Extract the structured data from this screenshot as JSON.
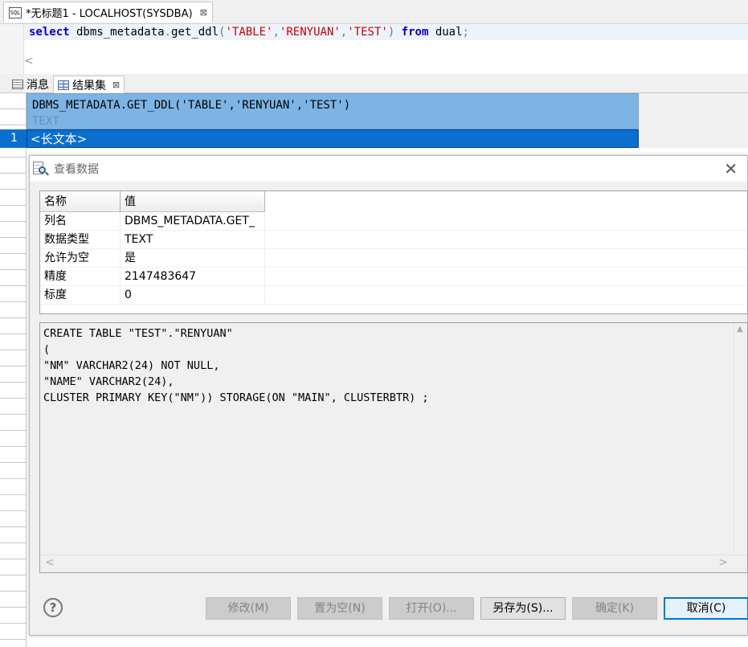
{
  "editor_tab": {
    "icon": "sql-icon",
    "title": "*无标题1 - LOCALHOST(SYSDBA)",
    "close": "⊠"
  },
  "editor": {
    "keyword_select": "select",
    "func": " dbms_metadata",
    "dot": ".",
    "func2": "get_ddl",
    "open": "(",
    "arg1": "'TABLE'",
    "comma1": ",",
    "arg2": "'RENYUAN'",
    "comma2": ",",
    "arg3": "'TEST'",
    "close": ") ",
    "keyword_from": "from",
    "table": " dual",
    "semicolon": ";",
    "scroll_left": "<"
  },
  "result_tabs": [
    {
      "label": "消息",
      "icon": "message-icon"
    },
    {
      "label": "结果集",
      "icon": "grid-icon",
      "close": "⊠"
    }
  ],
  "result_grid": {
    "column": "DBMS_METADATA.GET_DDL('TABLE','RENYUAN','TEST')",
    "column_type": "TEXT",
    "row_number": "1",
    "cell_value": "<长文本>"
  },
  "dialog": {
    "title": "查看数据",
    "close": "✕",
    "props_headers": [
      "名称",
      "值"
    ],
    "props_rows": [
      {
        "name": "列名",
        "value": "DBMS_METADATA.GET_"
      },
      {
        "name": "数据类型",
        "value": "TEXT"
      },
      {
        "name": "允许为空",
        "value": "是"
      },
      {
        "name": "精度",
        "value": "2147483647"
      },
      {
        "name": "标度",
        "value": "0"
      }
    ],
    "text_content": "CREATE TABLE \"TEST\".\"RENYUAN\"\n(\n\"NM\" VARCHAR2(24) NOT NULL,\n\"NAME\" VARCHAR2(24),\nCLUSTER PRIMARY KEY(\"NM\")) STORAGE(ON \"MAIN\", CLUSTERBTR) ;",
    "scroll_left": "<",
    "scroll_right": ">",
    "help": "?",
    "buttons": {
      "modify": "修改(M)",
      "set_null": "置为空(N)",
      "open": "打开(O)...",
      "save_as": "另存为(S)...",
      "ok": "确定(K)",
      "cancel": "取消(C)"
    }
  }
}
